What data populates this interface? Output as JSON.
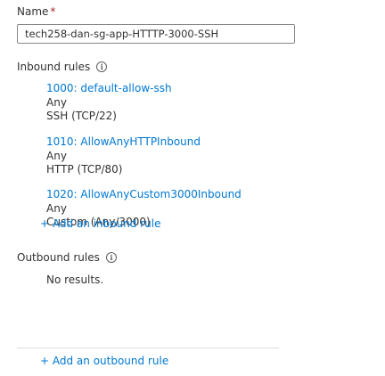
{
  "name_field": {
    "label": "Name",
    "required_marker": "*",
    "value": "tech258-dan-sg-app-HTTTP-3000-SSH"
  },
  "inbound": {
    "label": "Inbound rules",
    "info_icon": "info-icon",
    "rules": [
      {
        "title": "1000: default-allow-ssh",
        "source": "Any",
        "service": "SSH (TCP/22)"
      },
      {
        "title": "1010: AllowAnyHTTPInbound",
        "source": "Any",
        "service": "HTTP (TCP/80)"
      },
      {
        "title": "1020: AllowAnyCustom3000Inbound",
        "source": "Any",
        "service": "Custom (Any/3000)"
      }
    ],
    "add_label": "+ Add an inbound rule"
  },
  "outbound": {
    "label": "Outbound rules",
    "info_icon": "info-icon",
    "empty_text": "No results.",
    "add_label": "+ Add an outbound rule"
  },
  "colors": {
    "link": "#0078d4",
    "text": "#323130",
    "required": "#a4262c",
    "border": "#8a8886"
  }
}
